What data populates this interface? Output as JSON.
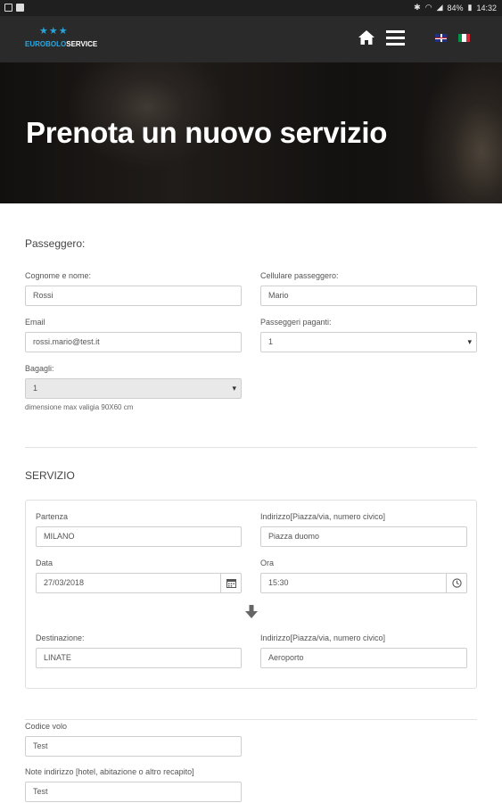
{
  "status_bar": {
    "battery": "84%",
    "time": "14:32"
  },
  "header": {
    "logo": {
      "stars": "★★★",
      "brand_part1": "EUROBOLO",
      "brand_part2": "SERVICE"
    },
    "home_icon": "home-icon",
    "menu_icon": "hamburger-menu-icon",
    "languages": [
      "en",
      "it"
    ]
  },
  "hero": {
    "title": "Prenota un nuovo servizio"
  },
  "passenger": {
    "section_title": "Passeggero:",
    "name": {
      "label": "Cognome e nome:",
      "value": "Rossi"
    },
    "phone": {
      "label": "Cellulare passeggero:",
      "value": "Mario"
    },
    "email": {
      "label": "Email",
      "value": "rossi.mario@test.it"
    },
    "paying": {
      "label": "Passeggeri paganti:",
      "value": "1"
    },
    "luggage": {
      "label": "Bagagli:",
      "value": "1",
      "hint": "dimensione max valigia 90X60 cm"
    }
  },
  "service": {
    "section_title": "SERVIZIO",
    "departure": {
      "label": "Partenza",
      "value": "MILANO"
    },
    "departure_address": {
      "label": "Indirizzo[Piazza/via, numero civico]",
      "value": "Piazza duomo"
    },
    "date": {
      "label": "Data",
      "value": "27/03/2018"
    },
    "time": {
      "label": "Ora",
      "value": "15:30"
    },
    "destination": {
      "label": "Destinazione:",
      "value": "LINATE"
    },
    "destination_address": {
      "label": "Indirizzo[Piazza/via, numero civico]",
      "value": "Aeroporto"
    }
  },
  "extra": {
    "flight_code": {
      "label": "Codice volo",
      "value": "Test"
    },
    "address_notes": {
      "label": "Note indirizzo [hotel, abitazione o altro recapito]",
      "value": "Test"
    }
  },
  "colors": {
    "navbar": "#2a2a2a",
    "accent": "#2aa7df",
    "disabled_field": "#e9e9e9"
  }
}
